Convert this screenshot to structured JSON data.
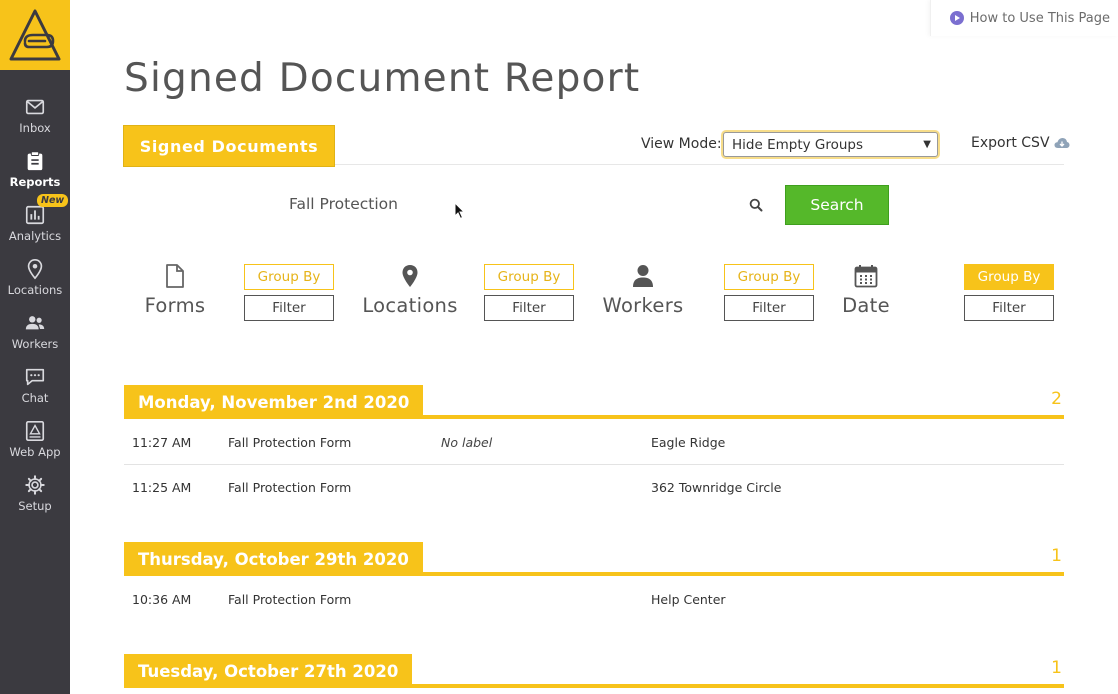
{
  "sidebar": {
    "items": [
      {
        "label": "Inbox",
        "icon": "mail-icon"
      },
      {
        "label": "Reports",
        "icon": "clipboard-icon",
        "active": true
      },
      {
        "label": "Analytics",
        "icon": "bar-chart-icon",
        "badge": "New"
      },
      {
        "label": "Locations",
        "icon": "map-pin-icon"
      },
      {
        "label": "Workers",
        "icon": "people-icon"
      },
      {
        "label": "Chat",
        "icon": "chat-bubble-icon"
      },
      {
        "label": "Web App",
        "icon": "web-app-icon"
      },
      {
        "label": "Setup",
        "icon": "gear-icon"
      }
    ]
  },
  "help_link": "How to Use This Page",
  "page_title": "Signed Document Report",
  "tab": "Signed Documents",
  "view_mode": {
    "label": "View Mode:",
    "selected": "Hide Empty Groups"
  },
  "export_label": "Export CSV",
  "search": {
    "value": "Fall Protection",
    "button": "Search"
  },
  "filters": [
    {
      "label": "Forms",
      "icon": "document-icon",
      "group_by": "Group By",
      "filter": "Filter",
      "group_active": false
    },
    {
      "label": "Locations",
      "icon": "map-pin-icon",
      "group_by": "Group By",
      "filter": "Filter",
      "group_active": false
    },
    {
      "label": "Workers",
      "icon": "person-icon",
      "group_by": "Group By",
      "filter": "Filter",
      "group_active": false
    },
    {
      "label": "Date",
      "icon": "calendar-icon",
      "group_by": "Group By",
      "filter": "Filter",
      "group_active": true
    }
  ],
  "groups": [
    {
      "date": "Monday, November 2nd 2020",
      "count": "2",
      "rows": [
        {
          "time": "11:27 AM",
          "form": "Fall Protection Form",
          "label": "No label",
          "location": "Eagle Ridge"
        },
        {
          "time": "11:25 AM",
          "form": "Fall Protection Form",
          "label": "",
          "location": "362 Townridge Circle"
        }
      ]
    },
    {
      "date": "Thursday, October 29th 2020",
      "count": "1",
      "rows": [
        {
          "time": "10:36 AM",
          "form": "Fall Protection Form",
          "label": "",
          "location": "Help Center"
        }
      ]
    },
    {
      "date": "Tuesday, October 27th 2020",
      "count": "1",
      "rows": []
    }
  ],
  "colors": {
    "accent": "#f7c31a",
    "sidebar": "#3b3a40",
    "search_button": "#55b82a"
  }
}
